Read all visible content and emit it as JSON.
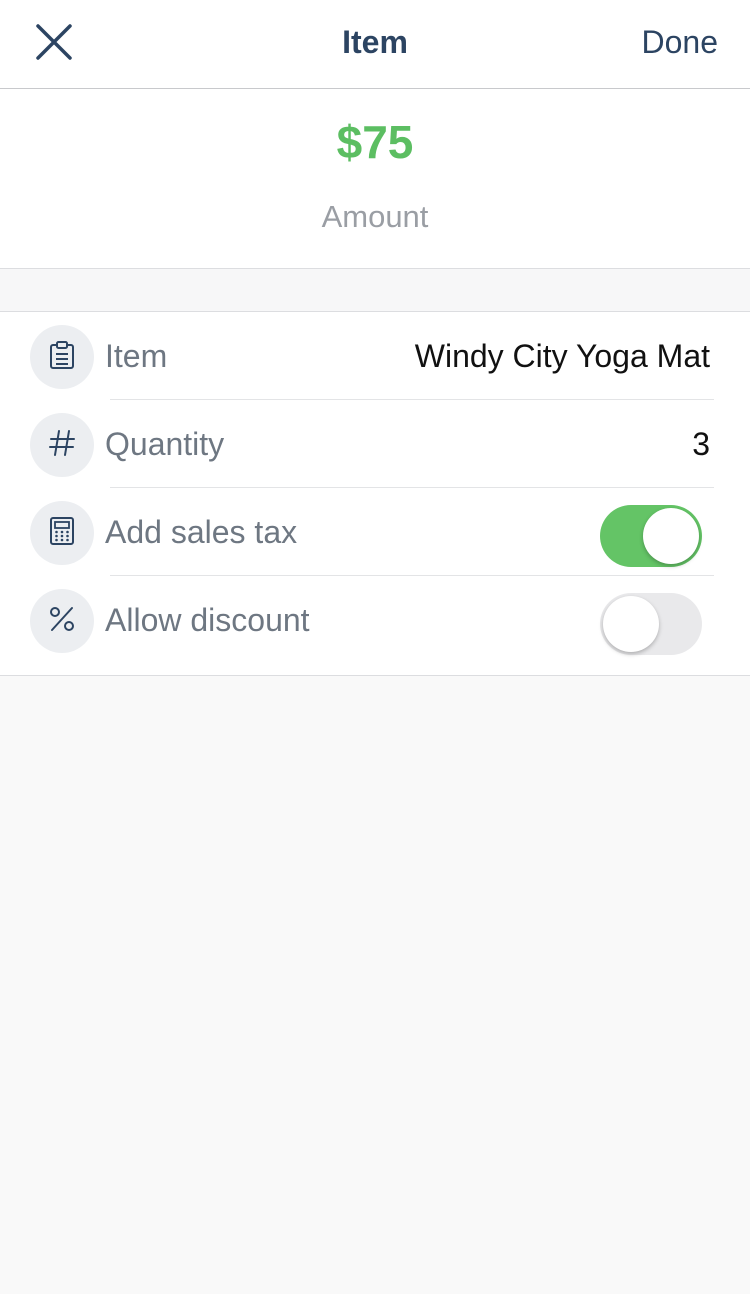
{
  "header": {
    "close_icon": "close-icon",
    "title": "Item",
    "done_label": "Done"
  },
  "amount": {
    "value": "$75",
    "label": "Amount",
    "color": "#5cbe62"
  },
  "form": {
    "rows": [
      {
        "icon": "clipboard-icon",
        "label": "Item",
        "value": "Windy City Yoga Mat"
      },
      {
        "icon": "hash-icon",
        "label": "Quantity",
        "value": "3"
      },
      {
        "icon": "calculator-icon",
        "label": "Add sales tax",
        "toggle_on": true
      },
      {
        "icon": "percent-icon",
        "label": "Allow discount",
        "toggle_on": false
      }
    ]
  },
  "colors": {
    "primary_text": "#2c4462",
    "toggle_on": "#64c466",
    "toggle_off": "#e9e9eb"
  }
}
